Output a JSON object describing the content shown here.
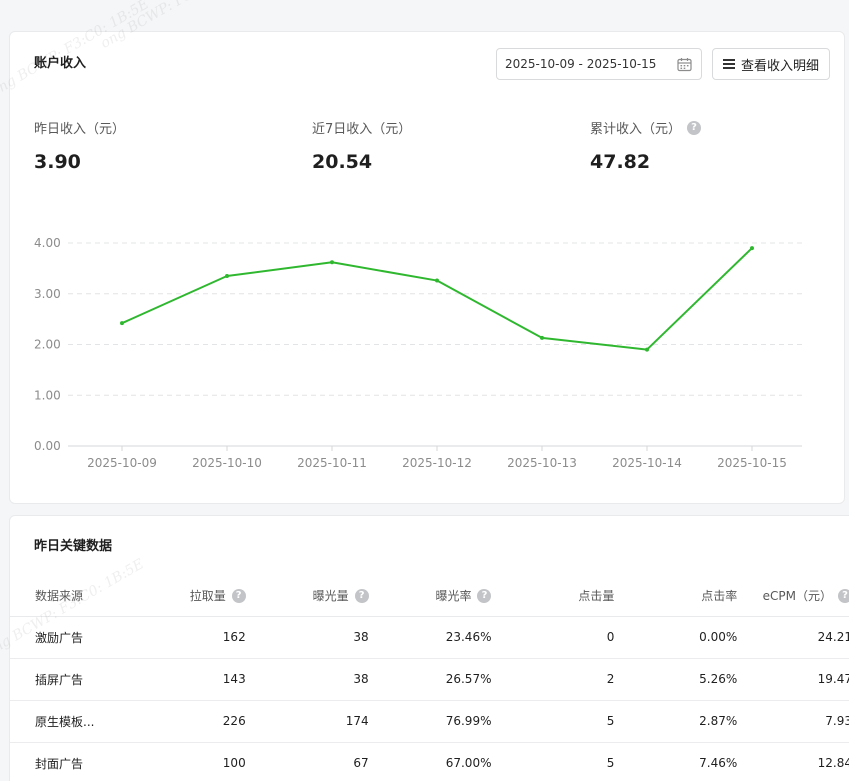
{
  "income": {
    "title": "账户收入",
    "date_range": "2025-10-09 - 2025-10-15",
    "detail_button": "查看收入明细",
    "stats": [
      {
        "label": "昨日收入（元）",
        "value": "3.90"
      },
      {
        "label": "近7日收入（元）",
        "value": "20.54"
      },
      {
        "label": "累计收入（元）",
        "value": "47.82",
        "help": "?"
      }
    ]
  },
  "chart_data": {
    "type": "line",
    "title": "",
    "xlabel": "",
    "ylabel": "",
    "categories": [
      "2025-10-09",
      "2025-10-10",
      "2025-10-11",
      "2025-10-12",
      "2025-10-13",
      "2025-10-14",
      "2025-10-15"
    ],
    "values": [
      2.42,
      3.35,
      3.62,
      3.26,
      2.13,
      1.9,
      3.9
    ],
    "y_ticks": [
      "0.00",
      "1.00",
      "2.00",
      "3.00",
      "4.00"
    ],
    "ylim": [
      0,
      4
    ],
    "grid": "dashed-horizontal",
    "line_color": "#2fb82f"
  },
  "key_data": {
    "title": "昨日关键数据",
    "help": "?",
    "columns": [
      "数据来源",
      "拉取量",
      "曝光量",
      "曝光率",
      "点击量",
      "点击率",
      "eCPM（元）"
    ],
    "rows": [
      [
        "激励广告",
        "162",
        "38",
        "23.46%",
        "0",
        "0.00%",
        "24.21"
      ],
      [
        "插屏广告",
        "143",
        "38",
        "26.57%",
        "2",
        "5.26%",
        "19.47"
      ],
      [
        "原生模板...",
        "226",
        "174",
        "76.99%",
        "5",
        "2.87%",
        "7.93"
      ],
      [
        "封面广告",
        "100",
        "67",
        "67.00%",
        "5",
        "7.46%",
        "12.84"
      ]
    ]
  },
  "watermark": "ong BCWP: F3:C0: 1B:5E"
}
